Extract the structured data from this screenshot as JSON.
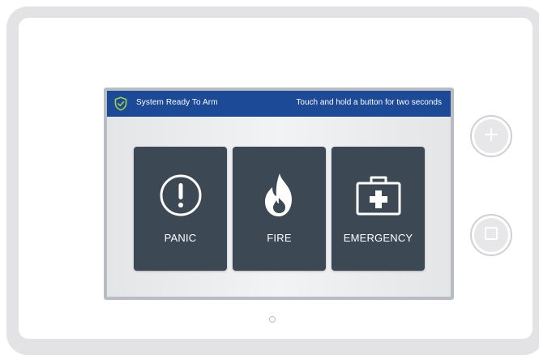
{
  "status_bar": {
    "status": "System Ready To Arm",
    "hint": "Touch and hold a button for two seconds",
    "shield_icon": "shield-check-icon",
    "background_color": "#1c4a96",
    "accent_color": "#9ed24a"
  },
  "buttons": [
    {
      "label": "PANIC",
      "icon": "exclamation-circle-icon"
    },
    {
      "label": "FIRE",
      "icon": "flame-icon"
    },
    {
      "label": "EMERGENCY",
      "icon": "first-aid-kit-icon"
    }
  ],
  "side_buttons": [
    {
      "icon": "plus-icon"
    },
    {
      "icon": "square-icon"
    }
  ],
  "colors": {
    "button_bg": "#3c4955",
    "device_frame": "#e3e3e5"
  }
}
